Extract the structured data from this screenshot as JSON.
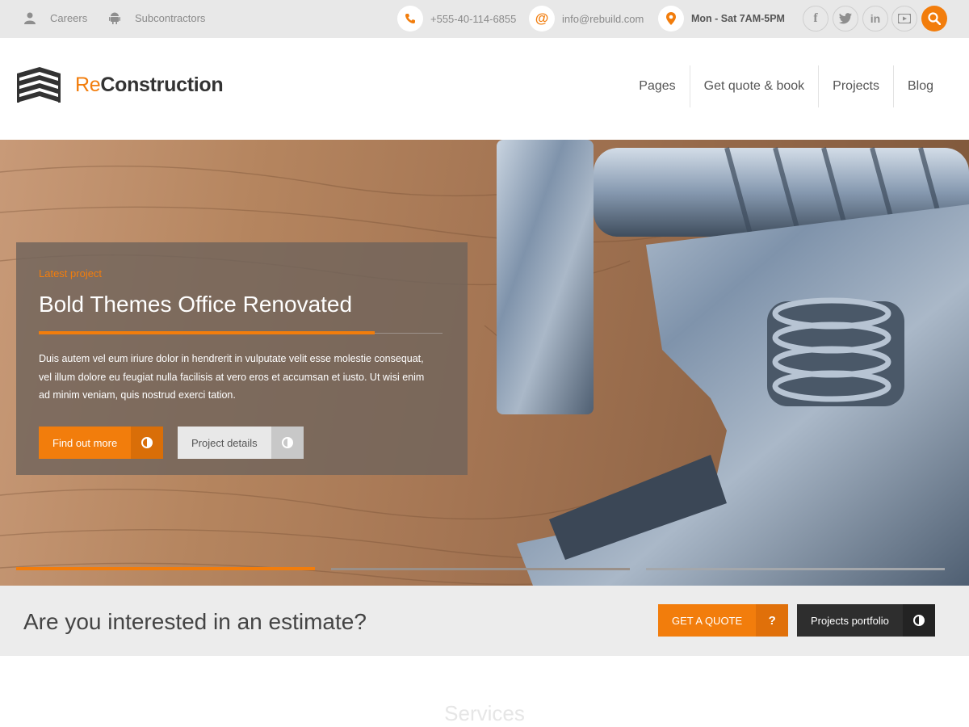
{
  "topbar": {
    "links": [
      {
        "label": "Careers",
        "icon": "user-icon"
      },
      {
        "label": "Subcontractors",
        "icon": "android-icon"
      }
    ],
    "phone": "+555-40-114-6855",
    "email": "info@rebuild.com",
    "hours": "Mon - Sat 7AM-5PM",
    "social": [
      {
        "name": "facebook",
        "glyph": "f"
      },
      {
        "name": "twitter",
        "glyph": "t"
      },
      {
        "name": "linkedin",
        "glyph": "in"
      },
      {
        "name": "youtube",
        "glyph": "yt"
      }
    ]
  },
  "header": {
    "logo_prefix": "Re",
    "logo_suffix": "Construction",
    "nav": [
      "Pages",
      "Get quote & book",
      "Projects",
      "Blog"
    ]
  },
  "hero": {
    "kicker": "Latest project",
    "title": "Bold Themes Office Renovated",
    "text": "Duis autem vel eum iriure dolor in hendrerit in vulputate velit esse molestie consequat, vel illum dolore eu feugiat nulla facilisis at vero eros et accumsan et iusto. Ut wisi enim ad minim veniam, quis nostrud exerci tation.",
    "primary_button": "Find out more",
    "secondary_button": "Project details",
    "slides_total": 3,
    "slide_active": 1
  },
  "estimate": {
    "title": "Are you interested in an estimate?",
    "quote_button": "GET A QUOTE",
    "quote_icon": "?",
    "portfolio_button": "Projects portfolio"
  },
  "services": {
    "title": "Services"
  },
  "colors": {
    "accent": "#f27d0c",
    "topbar_bg": "#e8e8e8",
    "dark_button": "#2e2e2e"
  }
}
